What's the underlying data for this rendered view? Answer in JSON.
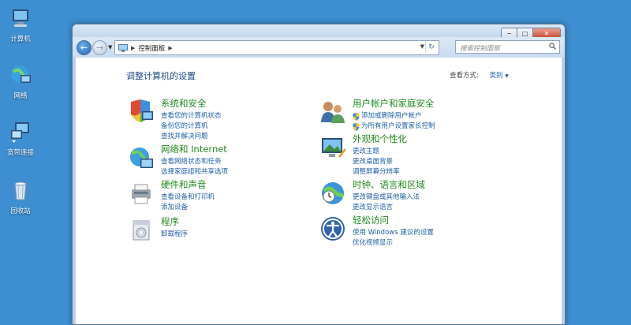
{
  "desktop": {
    "icons": [
      {
        "label": "计算机",
        "icon": "computer-icon"
      },
      {
        "label": "网络",
        "icon": "network-icon"
      },
      {
        "label": "宽带连接",
        "icon": "broadband-icon"
      },
      {
        "label": "回收站",
        "icon": "recycle-bin-icon"
      }
    ]
  },
  "window": {
    "caption": {
      "minimize": "−",
      "maximize": "□",
      "close": "✕"
    },
    "address": {
      "crumb": "控制面板"
    },
    "search": {
      "placeholder": "搜索控制面板"
    },
    "page_title": "调整计算机的设置",
    "view_by": {
      "label": "查看方式:",
      "value": "类别"
    },
    "categories": [
      {
        "title": "系统和安全",
        "icon": "system-security-icon",
        "links": [
          "查看您的计算机状态",
          "备份您的计算机",
          "查找并解决问题"
        ]
      },
      {
        "title": "网络和 Internet",
        "icon": "network-internet-icon",
        "links": [
          "查看网络状态和任务",
          "选择家庭组和共享选项"
        ]
      },
      {
        "title": "硬件和声音",
        "icon": "hardware-sound-icon",
        "links": [
          "查看设备和打印机",
          "添加设备"
        ]
      },
      {
        "title": "程序",
        "icon": "programs-icon",
        "links": [
          "卸载程序"
        ]
      },
      {
        "title": "用户帐户和家庭安全",
        "icon": "user-accounts-icon",
        "links": [
          "添加或删除用户帐户",
          "为所有用户设置家长控制"
        ]
      },
      {
        "title": "外观和个性化",
        "icon": "appearance-icon",
        "links": [
          "更改主题",
          "更改桌面背景",
          "调整屏幕分辨率"
        ]
      },
      {
        "title": "时钟、语言和区域",
        "icon": "clock-language-icon",
        "links": [
          "更改键盘或其他输入法",
          "更改显示语言"
        ]
      },
      {
        "title": "轻松访问",
        "icon": "ease-of-access-icon",
        "links": [
          "使用 Windows 建议的设置",
          "优化视频显示"
        ]
      }
    ]
  }
}
